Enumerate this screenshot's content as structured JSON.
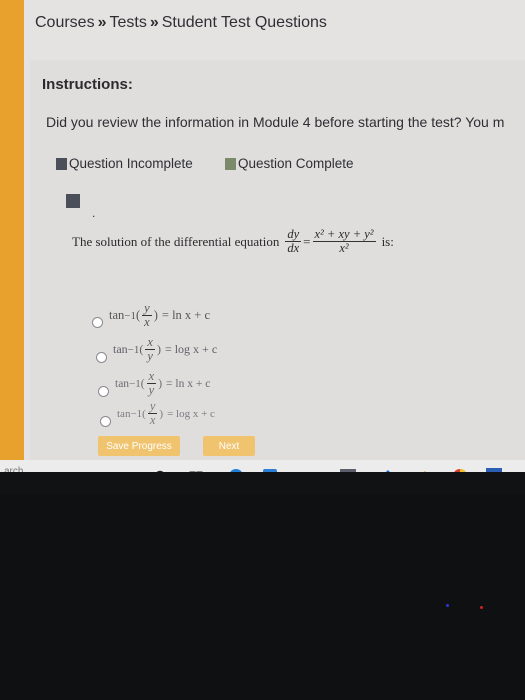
{
  "breadcrumb": {
    "items": [
      "Courses",
      "Tests",
      "Student Test Questions"
    ],
    "separator": "»"
  },
  "instructions": {
    "title": "Instructions:",
    "text": "Did you review the information in Module 4 before starting the test? You m"
  },
  "legend": {
    "incomplete_label": "Question Incomplete",
    "complete_label": "Question Complete",
    "incomplete_color": "#4a4f5a",
    "complete_color": "#7a8a6a"
  },
  "question": {
    "marker_dot": ".",
    "prefix": "The solution of the differential equation",
    "lhs_num": "dy",
    "lhs_den": "dx",
    "equals": "=",
    "rhs_num": "x² + xy + y²",
    "rhs_den": "x²",
    "suffix": "is:"
  },
  "options": [
    {
      "tan": "tan",
      "sup": "−1",
      "paren_open": "(",
      "num": "y",
      "den": "x",
      "paren_close": ")",
      "rhs": "= ln x + c"
    },
    {
      "tan": "tan",
      "sup": "−1",
      "paren_open": "(",
      "num": "x",
      "den": "y",
      "paren_close": ")",
      "rhs": "= log x + c"
    },
    {
      "tan": "tan",
      "sup": "−1",
      "paren_open": "(",
      "num": "x",
      "den": "y",
      "paren_close": ")",
      "rhs": "= ln x + c"
    },
    {
      "tan": "tan",
      "sup": "−1",
      "paren_open": "(",
      "num": "y",
      "den": "x",
      "paren_close": ")",
      "rhs": "= log x + c"
    }
  ],
  "buttons": {
    "save_progress": "Save Progress",
    "next": "Next"
  },
  "taskbar": {
    "search_text": "arch",
    "icons": [
      "cortana-icon",
      "task-view-icon",
      "edge-icon",
      "store-icon",
      "photos-icon",
      "maps-icon",
      "paint-icon",
      "chrome-icon",
      "word-icon"
    ]
  }
}
